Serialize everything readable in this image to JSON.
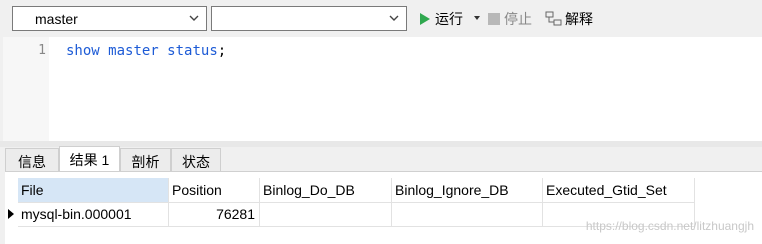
{
  "toolbar": {
    "database_select_value": "master",
    "schema_select_value": "",
    "run_label": "运行",
    "stop_label": "停止",
    "explain_label": "解释"
  },
  "editor": {
    "line_number": "1",
    "tokens": [
      "show",
      "master",
      "status",
      ";"
    ]
  },
  "tabs": [
    "信息",
    "结果 1",
    "剖析",
    "状态"
  ],
  "result": {
    "columns": [
      "File",
      "Position",
      "Binlog_Do_DB",
      "Binlog_Ignore_DB",
      "Executed_Gtid_Set"
    ],
    "rows": [
      [
        "mysql-bin.000001",
        "76281",
        "",
        "",
        ""
      ]
    ]
  },
  "watermark": "https://blog.csdn.net/litzhuangjh",
  "colors": {
    "keyword": "#1d5bd6",
    "run_icon": "#2fa84f",
    "selected_header": "#d6e6f6"
  }
}
